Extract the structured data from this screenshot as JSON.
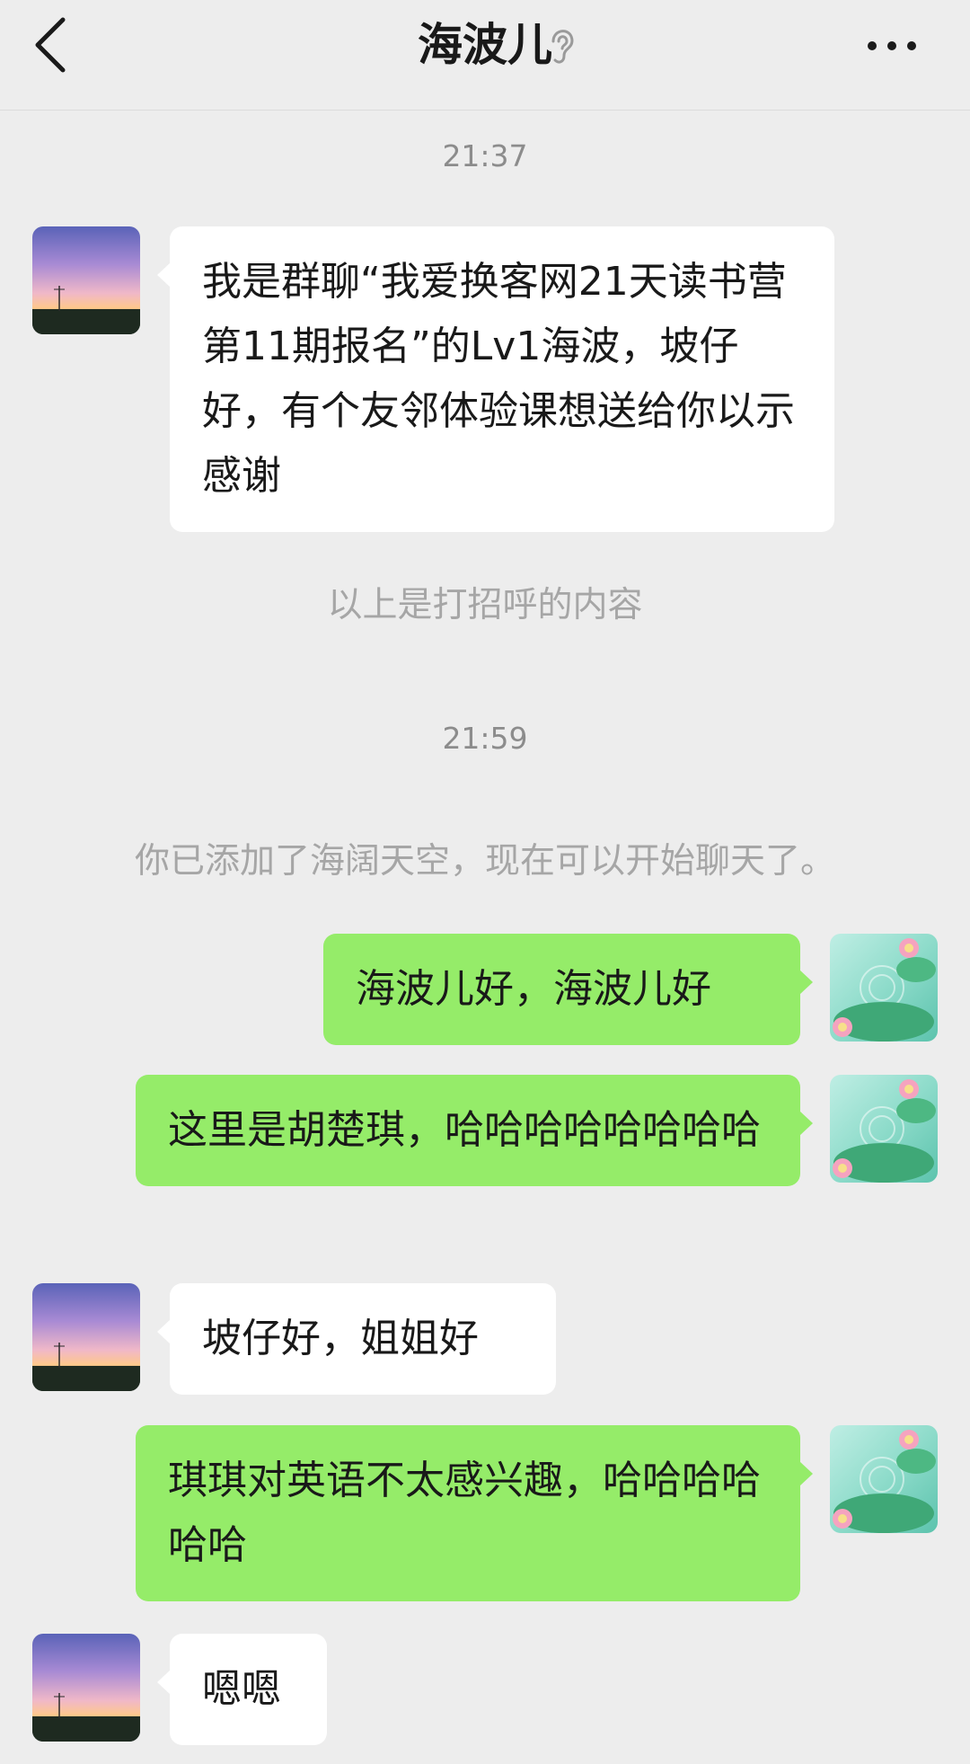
{
  "header": {
    "title": "海波儿",
    "back_icon": "chevron-left-icon",
    "ear_icon": "ear-icon",
    "more_icon": "more-horizontal-icon"
  },
  "messages": [
    {
      "type": "time",
      "text": "21:37"
    },
    {
      "type": "incoming",
      "text": "我是群聊“我爱换客网21天读书营 第11期报名”的Lv1海波，坡仔好，有个友邻体验课想送给你以示感谢"
    },
    {
      "type": "system",
      "text": "以上是打招呼的内容"
    },
    {
      "type": "time",
      "text": "21:59"
    },
    {
      "type": "system",
      "text": "你已添加了海阔天空，现在可以开始聊天了。"
    },
    {
      "type": "outgoing",
      "text": "海波儿好，海波儿好"
    },
    {
      "type": "outgoing",
      "text": "这里是胡楚琪，哈哈哈哈哈哈哈哈"
    },
    {
      "type": "incoming",
      "text": "坡仔好，姐姐好"
    },
    {
      "type": "outgoing",
      "text": "琪琪对英语不太感兴趣，哈哈哈哈哈哈"
    },
    {
      "type": "incoming",
      "text": "嗯嗯"
    }
  ],
  "colors": {
    "background": "#ededed",
    "outgoing_bubble": "#95ec69",
    "incoming_bubble": "#ffffff",
    "meta_text": "#8c8c8c"
  }
}
